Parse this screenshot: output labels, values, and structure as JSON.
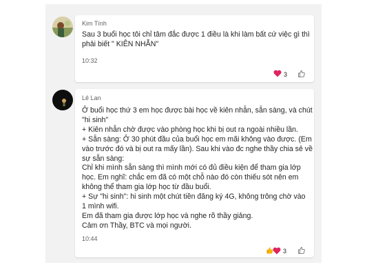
{
  "messages": [
    {
      "author": "Kim Tính",
      "lines": [
        "Sau 3 buổi học tôi chỉ tâm đắc được 1 điều là khi làm bất cứ việc gì thì",
        "phải biết \" KIÊN NHẪN\""
      ],
      "time": "10:32",
      "reactions": [
        "heart"
      ],
      "reaction_count": "3",
      "accent": "#d13438"
    },
    {
      "author": "Lê Lan",
      "lines": [
        "Ở buổi học thứ 3 em học được bài học về kiên nhẫn, sẵn sàng, và chút",
        "\"hi sinh\"",
        "+ Kiên nhẫn chờ được vào phòng học khi bị out ra ngoài nhiều lần.",
        "+ Sẵn sàng: Ở 30 phút đầu của buổi học em mãi không vào được. (Em",
        "vào trước đó và bị out ra mấy lần). Sau khi vào đc nghe thầy chia sẻ về",
        "sự sẵn sàng:",
        "Chỉ khi mình sẵn sàng thì mình mới có đủ điều kiện để tham gia lớp",
        "học. Em nghĩ: chắc em đã có một chỗ nào đó còn thiếu sót nên em",
        "không thể tham gia lớp học từ đầu buổi.",
        "+ Sự \"hi sinh\": hi sinh một chút tiền đăng  ký 4G, không trông chờ vào",
        "1 mình wifi.",
        "Em đã tham gia được lớp học và nghe rõ thầy giảng.",
        "Cảm ơn Thầy, BTC và mọi người."
      ],
      "time": "10:44",
      "reactions": [
        "thumbs-up",
        "heart"
      ],
      "reaction_count": "3"
    }
  ],
  "icons": {
    "like": "like-outline-icon",
    "heart": "heart-emoji-icon",
    "thumbs": "thumbs-up-emoji-icon"
  },
  "colors": {
    "background": "#f2f2f2",
    "card": "#ffffff",
    "text": "#242424",
    "muted": "#616161",
    "heart": "#e0245e",
    "thumbs": "#f5b400"
  }
}
